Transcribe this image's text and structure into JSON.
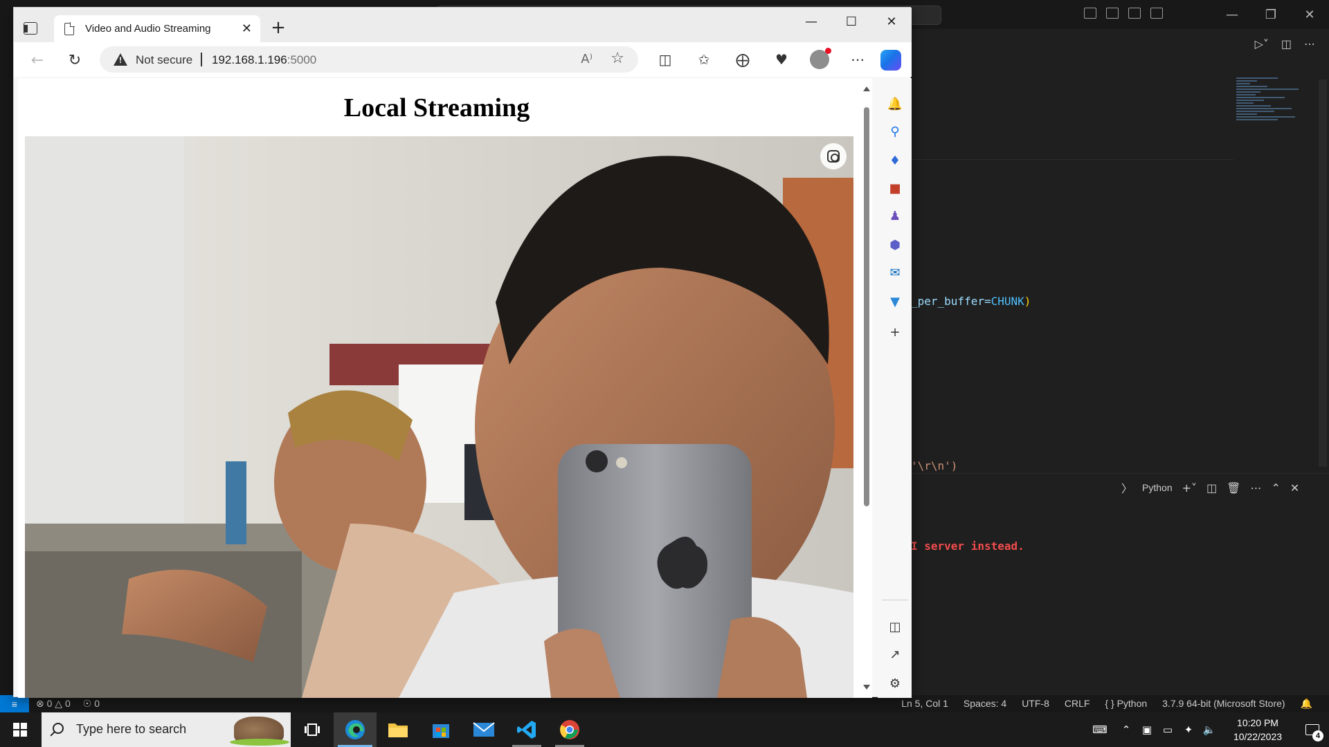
{
  "edge": {
    "tab_title": "Video and Audio Streaming",
    "security_label": "Not secure",
    "url_host": "192.168.1.196",
    "url_port": ":5000",
    "page_heading": "Local Streaming"
  },
  "vscode": {
    "code_line_1_prefix": "_per_buffer=",
    "code_line_1_const": "CHUNK",
    "code_line_1_suffix": ")",
    "code_line_2": "'\\r\\n')",
    "terminal_error": "I server instead.",
    "terminal_profile": "Python",
    "status": {
      "errors": "0",
      "warnings": "0",
      "ports": "0",
      "position": "Ln 5, Col 1",
      "spaces": "Spaces: 4",
      "encoding": "UTF-8",
      "eol": "CRLF",
      "language": "Python",
      "interpreter": "3.7.9 64-bit (Microsoft Store)"
    }
  },
  "taskbar": {
    "search_placeholder": "Type here to search",
    "time": "10:20 PM",
    "date": "10/22/2023",
    "notification_count": "4"
  },
  "colors": {
    "vscode_bg": "#1f1f1f",
    "terminal_error": "#f14c4c",
    "edge_chrome": "#f7f7f7",
    "taskbar_accent": "#76b9ed",
    "statusbar_remote": "#0078d4"
  },
  "icons": {
    "edge_toolbar": [
      "split-screen-icon",
      "favorites-icon",
      "collections-icon",
      "browser-essentials-icon",
      "profile-avatar",
      "more-icon",
      "copilot-icon"
    ],
    "edge_sidebar": [
      "bell-icon",
      "search-icon",
      "shopping-tag-icon",
      "tools-briefcase-icon",
      "games-icon",
      "microsoft365-icon",
      "outlook-icon",
      "drop-icon",
      "add-icon",
      "sidebar-toggle-icon",
      "open-external-icon",
      "settings-gear-icon"
    ],
    "taskbar_apps": [
      "task-view-icon",
      "edge-icon",
      "file-explorer-icon",
      "microsoft-store-icon",
      "mail-icon",
      "vscode-icon",
      "chrome-icon"
    ]
  }
}
